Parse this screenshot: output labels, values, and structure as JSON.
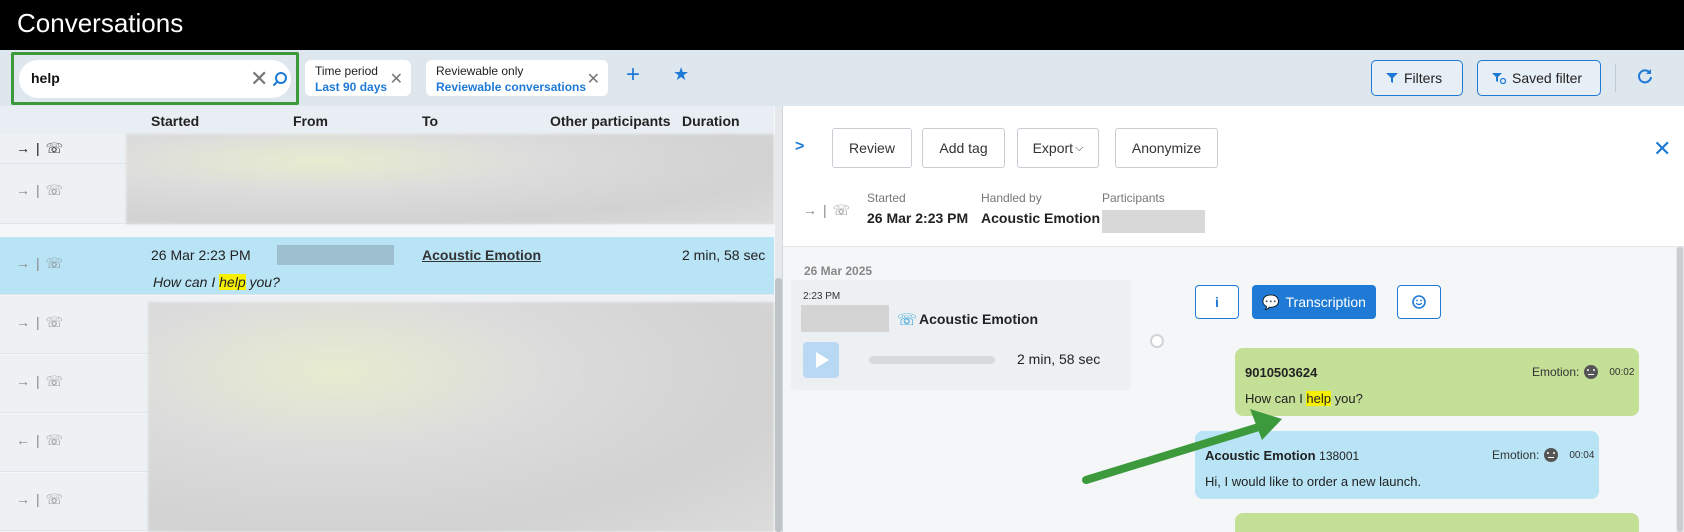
{
  "app": {
    "title": "Conversations"
  },
  "search": {
    "value": "help",
    "clear_label": "✕"
  },
  "chips": [
    {
      "key": "Time period",
      "value": "Last 90 days"
    },
    {
      "key": "Reviewable only",
      "value": "Reviewable conversations"
    }
  ],
  "toolbar": {
    "add_label": "+",
    "star_label": "★",
    "filters_label": "Filters",
    "saved_filter_label": "Saved filter"
  },
  "list": {
    "columns": [
      "Started",
      "From",
      "To",
      "Other participants",
      "Duration"
    ],
    "selected": {
      "started": "26 Mar 2:23 PM",
      "to": "Acoustic Emotion",
      "duration": "2 min, 58 sec",
      "snippet_before": "How can I ",
      "snippet_highlight": "help",
      "snippet_after": " you?"
    }
  },
  "detail": {
    "actions": [
      "Review",
      "Add tag",
      "Export",
      "Anonymize"
    ],
    "meta": {
      "started_label": "Started",
      "started": "26 Mar 2:23 PM",
      "handled_label": "Handled by",
      "handled": "Acoustic Emotion",
      "participants_label": "Participants"
    },
    "timeline": {
      "date": "26 Mar 2025",
      "call": {
        "time": "2:23 PM",
        "name": "Acoustic Emotion",
        "duration": "2 min, 58 sec"
      },
      "tabs": {
        "info": "i",
        "transcription": "Transcription"
      },
      "messages": [
        {
          "speaker": "9010503624",
          "ext": "",
          "emotion_label": "Emotion:",
          "timestamp": "00:02",
          "text_before": "How can I ",
          "text_highlight": "help",
          "text_after": " you?"
        },
        {
          "speaker": "Acoustic Emotion",
          "ext": "138001",
          "emotion_label": "Emotion:",
          "timestamp": "00:04",
          "text": "Hi, I would like to order a new launch."
        }
      ]
    }
  },
  "colors": {
    "accent": "#1f7ad6",
    "selected_row": "#b8e4f6",
    "caller_bubble": "#c4df96",
    "annotation_green": "#3c9a3c",
    "highlight": "#f7f000"
  }
}
